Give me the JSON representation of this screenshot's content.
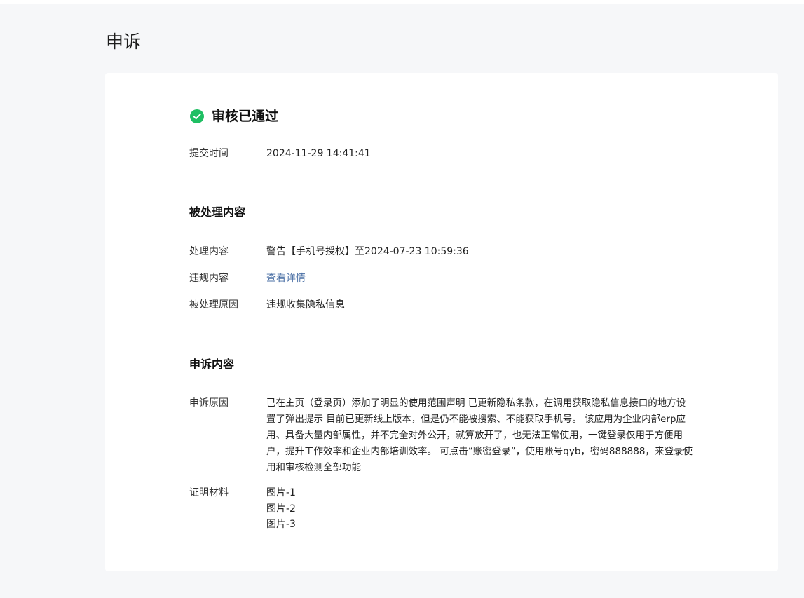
{
  "page": {
    "title": "申诉"
  },
  "status": {
    "text": "审核已通过",
    "icon": "check-circle-icon",
    "color": "#1fbf63"
  },
  "submit": {
    "label": "提交时间",
    "value": "2024-11-29 14:41:41"
  },
  "handled": {
    "title": "被处理内容",
    "rows": [
      {
        "label": "处理内容",
        "value": "警告【手机号授权】至2024-07-23 10:59:36"
      },
      {
        "label": "违规内容",
        "value": "查看详情"
      },
      {
        "label": "被处理原因",
        "value": "违规收集隐私信息"
      }
    ]
  },
  "appeal": {
    "title": "申诉内容",
    "reason_label": "申诉原因",
    "reason_value": "已在主页（登录页）添加了明显的使用范围声明 已更新隐私条款，在调用获取隐私信息接口的地方设置了弹出提示 目前已更新线上版本，但是仍不能被搜索、不能获取手机号。 该应用为企业内部erp应用、具备大量内部属性，并不完全对外公开，就算放开了，也无法正常使用，一键登录仅用于方便用户，提升工作效率和企业内部培训效率。 可点击“账密登录”，使用账号qyb，密码888888，来登录使用和审核检测全部功能",
    "materials_label": "证明材料",
    "materials": [
      "图片-1",
      "图片-2",
      "图片-3"
    ]
  },
  "colors": {
    "link": "#4a6fa5",
    "background": "#f6f7f9",
    "card": "#ffffff"
  }
}
